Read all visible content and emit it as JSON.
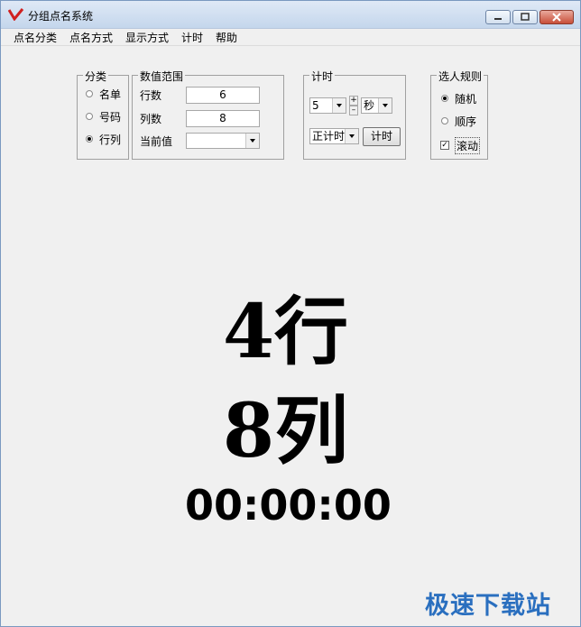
{
  "window": {
    "title": "分组点名系统"
  },
  "menu": [
    "点名分类",
    "点名方式",
    "显示方式",
    "计时",
    "帮助"
  ],
  "category": {
    "legend": "分类",
    "options": [
      "名单",
      "号码",
      "行列"
    ],
    "selected": 2
  },
  "range": {
    "legend": "数值范围",
    "rows_label": "行数",
    "rows_value": "6",
    "cols_label": "列数",
    "cols_value": "8",
    "current_label": "当前值",
    "current_value": ""
  },
  "timing": {
    "legend": "计时",
    "amount": "5",
    "unit": "秒",
    "mode": "正计时",
    "button": "计时"
  },
  "rule": {
    "legend": "选人规则",
    "options": [
      "随机",
      "顺序"
    ],
    "selected": 0,
    "scroll_label": "滚动",
    "scroll_checked": true
  },
  "display": {
    "row_text": "4行",
    "col_text": "8列",
    "clock": "00:00:00"
  },
  "watermark": "极速下载站"
}
